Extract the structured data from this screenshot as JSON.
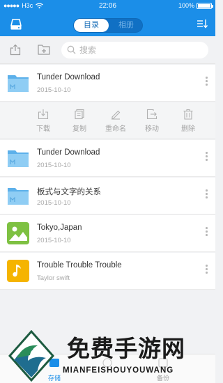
{
  "status_bar": {
    "carrier": "H3c",
    "time": "22:06",
    "battery": "100%"
  },
  "header": {
    "segments": [
      {
        "label": "目录",
        "active": true
      },
      {
        "label": "相册",
        "active": false
      }
    ]
  },
  "search": {
    "placeholder": "搜索",
    "value": ""
  },
  "files": [
    {
      "name": "Tunder Download",
      "date": "2015-10-10",
      "type": "folder"
    },
    {
      "name": "Tunder Download",
      "date": "2015-10-10",
      "type": "folder"
    },
    {
      "name": "板式与文字的关系",
      "date": "2015-10-10",
      "type": "folder"
    },
    {
      "name": "Tokyo,Japan",
      "date": "2015-10-10",
      "type": "image"
    },
    {
      "name": "Trouble Trouble Trouble",
      "date": "Taylor swift",
      "type": "music"
    }
  ],
  "file_actions": [
    {
      "label": "下载",
      "icon": "download-icon"
    },
    {
      "label": "复制",
      "icon": "copy-icon"
    },
    {
      "label": "重命名",
      "icon": "rename-icon"
    },
    {
      "label": "移动",
      "icon": "move-icon"
    },
    {
      "label": "删除",
      "icon": "delete-icon"
    }
  ],
  "tabs": [
    {
      "label": "存储",
      "active": true
    },
    {
      "label": "",
      "active": false
    },
    {
      "label": "备份",
      "active": false
    }
  ],
  "watermark": {
    "text_cn": "免费手游网",
    "text_en": "MIANFEISHOUYOUWANG"
  },
  "colors": {
    "primary": "#1b8ee8",
    "folder": "#7cc2f0",
    "image": "#7ec142",
    "music": "#f5b400"
  }
}
